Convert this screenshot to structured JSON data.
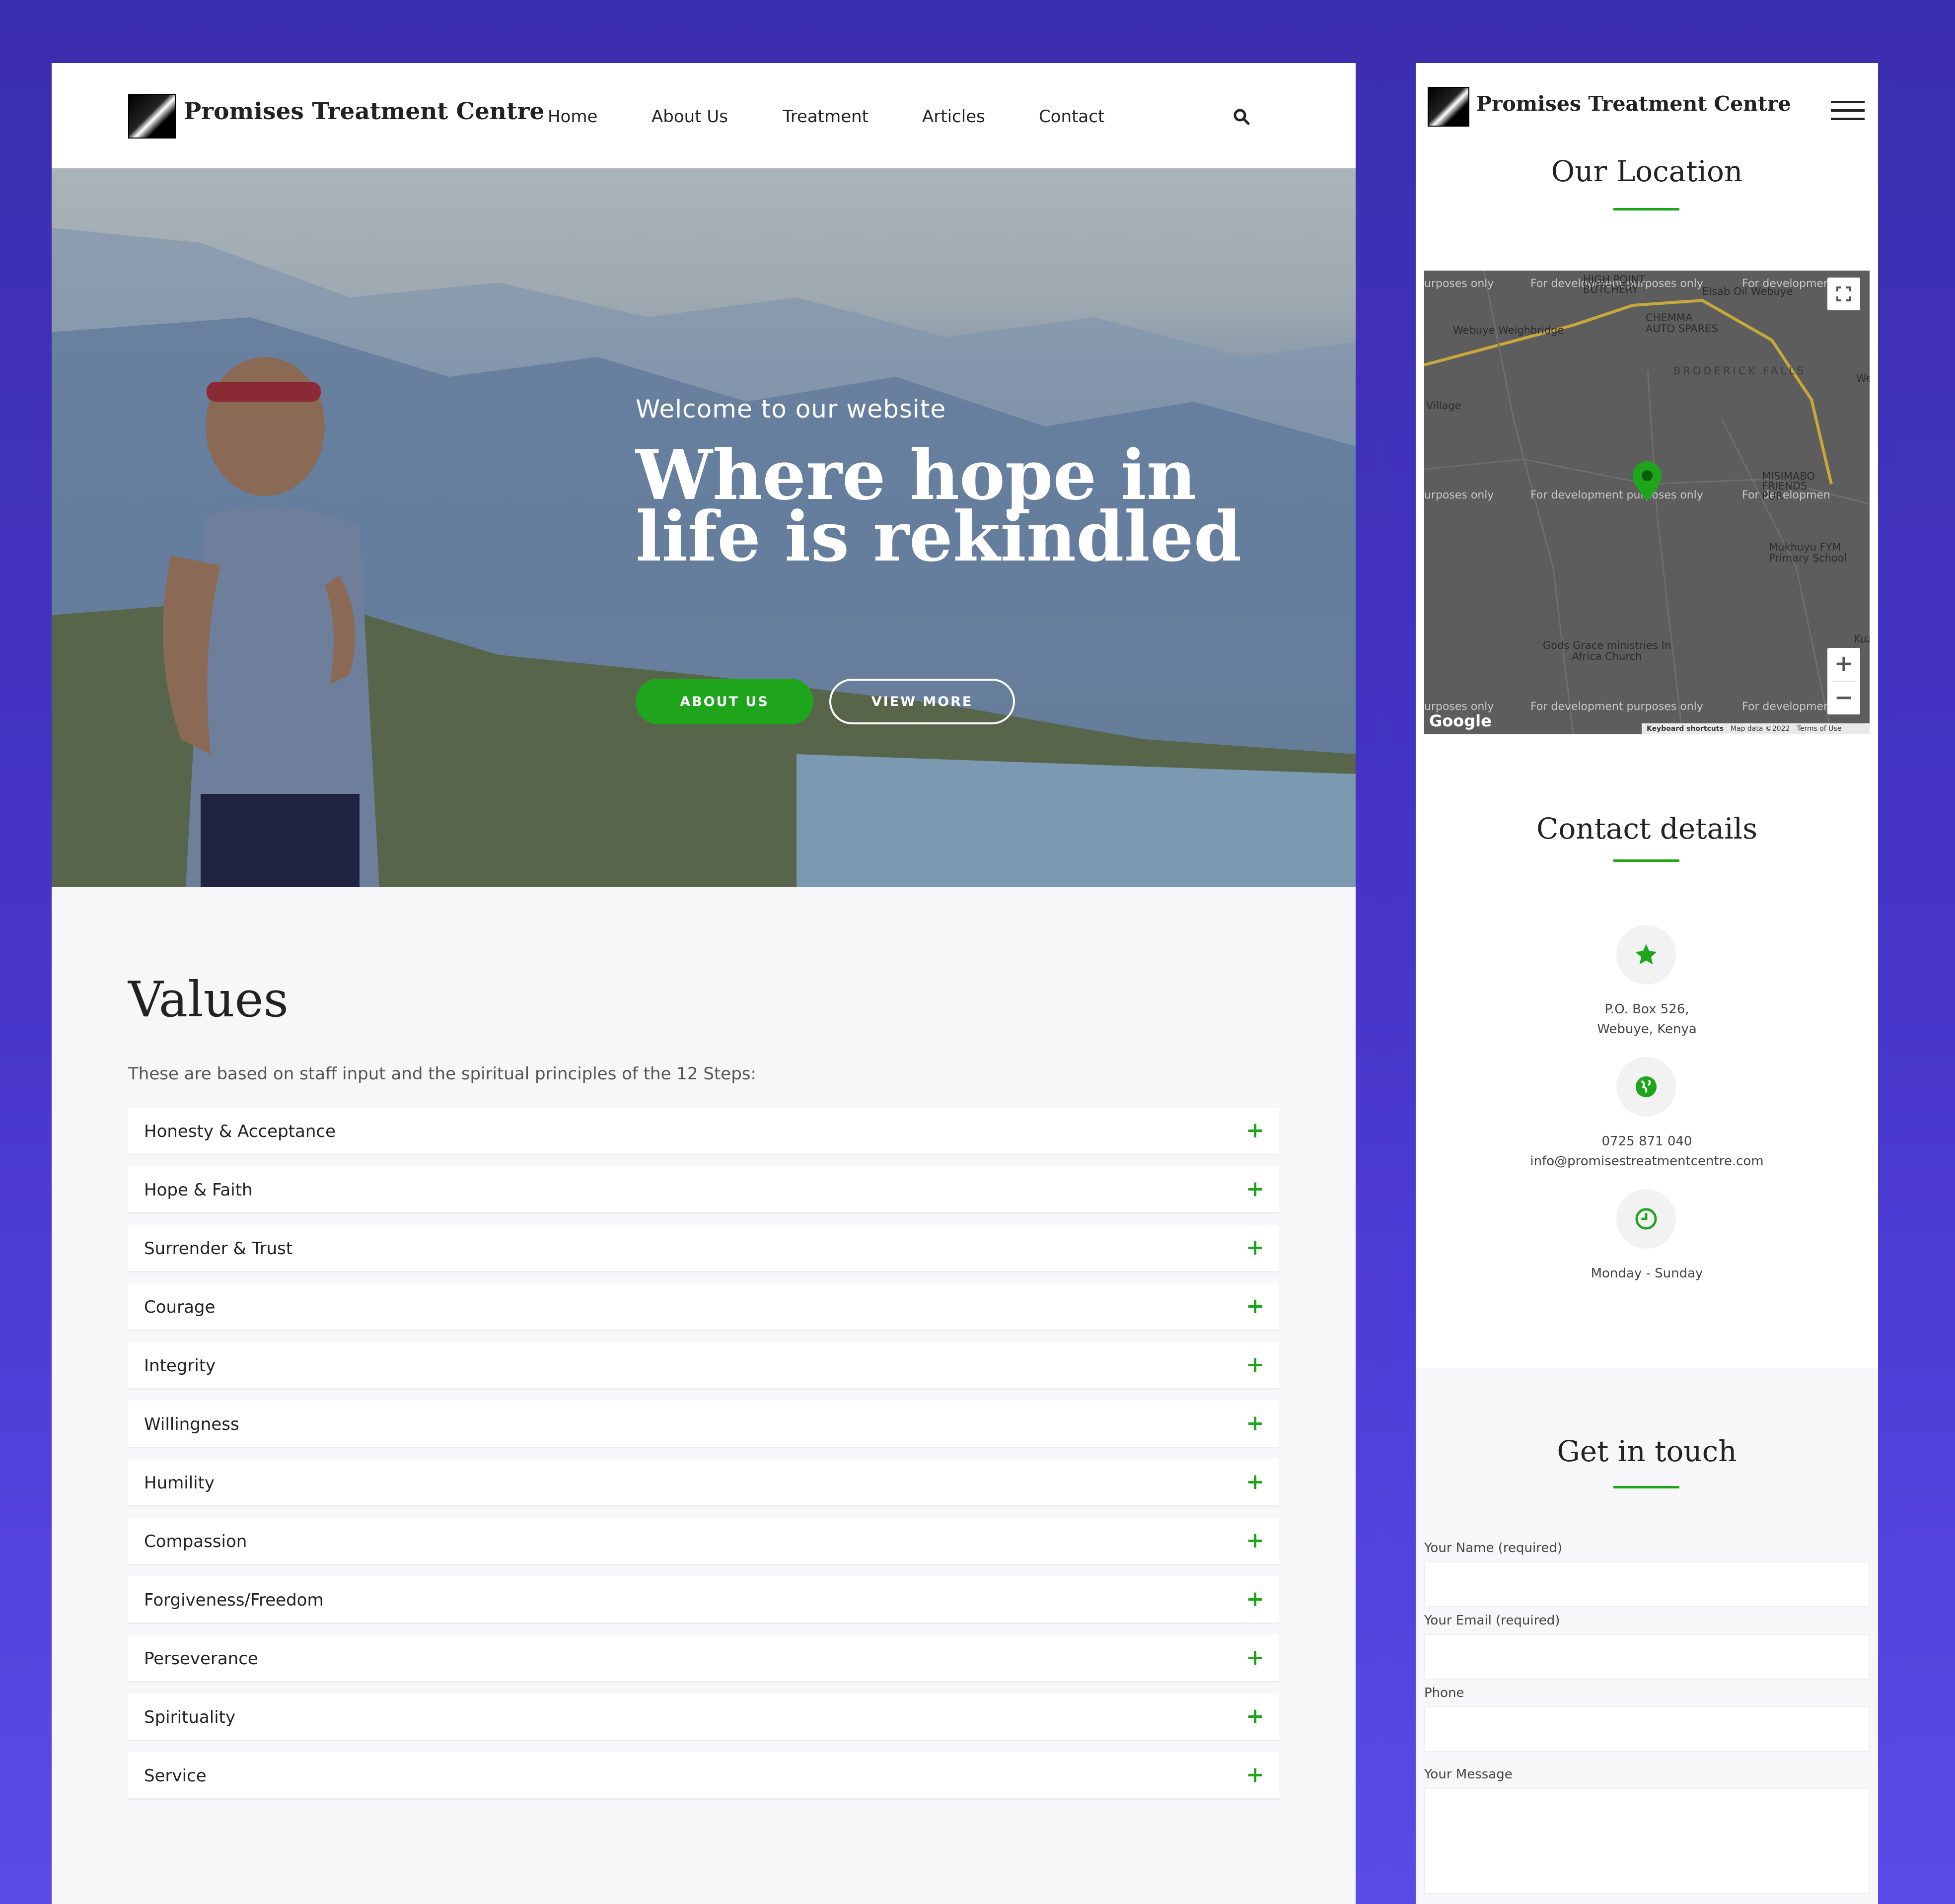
{
  "desktop": {
    "brand": "Promises Treatment Centre",
    "nav": [
      "Home",
      "About Us",
      "Treatment",
      "Articles",
      "Contact"
    ],
    "hero": {
      "welcome": "Welcome to our website",
      "title": "Where hope in life is rekindled",
      "btn_about": "ABOUT US",
      "btn_view": "VIEW MORE"
    },
    "values": {
      "title": "Values",
      "intro": "These are based on staff input and the spiritual principles of the 12 Steps:",
      "items": [
        "Honesty & Acceptance",
        "Hope & Faith",
        "Surrender & Trust",
        "Courage",
        "Integrity",
        "Willingness",
        "Humility",
        "Compassion",
        "Forgiveness/Freedom",
        "Perseverance",
        "Spirituality",
        "Service"
      ]
    }
  },
  "mobile": {
    "brand": "Promises Treatment Centre",
    "location_title": "Our Location",
    "map": {
      "dev_text": "For development purposes only",
      "dev_text_left": "urposes only",
      "dev_text_right": "For developmen",
      "labels": {
        "weighbridge": "Webuye Weighbridge",
        "chemma": "CHEMMA AUTO SPARES",
        "broderick": "BRODERICK FALLS",
        "village": "Village",
        "misimabo": "MISIMABO FRIENDS PUR",
        "mukhuyu": "Mukhuyu FYM Primary School",
        "gods_grace": "Gods Grace ministries In Africa Church",
        "high_point": "HIGH POINT BUTCHERY",
        "elsab": "Elsab Oil Webuye",
        "kuz": "Kuz",
        "we": "We"
      },
      "google": "Google",
      "footer": [
        "Keyboard shortcuts",
        "Map data ©2022",
        "Terms of Use"
      ],
      "zoom_in": "+",
      "zoom_out": "−"
    },
    "contact_title": "Contact details",
    "contact": {
      "address_1": "P.O. Box 526,",
      "address_2": "Webuye, Kenya",
      "phone": "0725 871 040",
      "email": "info@promisestreatmentcentre.com",
      "hours": "Monday - Sunday"
    },
    "form": {
      "title": "Get in touch",
      "name_label": "Your Name (required)",
      "email_label": "Your Email (required)",
      "phone_label": "Phone",
      "message_label": "Your Message"
    }
  },
  "colors": {
    "accent": "#1fa51c",
    "background": "#4735c9"
  }
}
